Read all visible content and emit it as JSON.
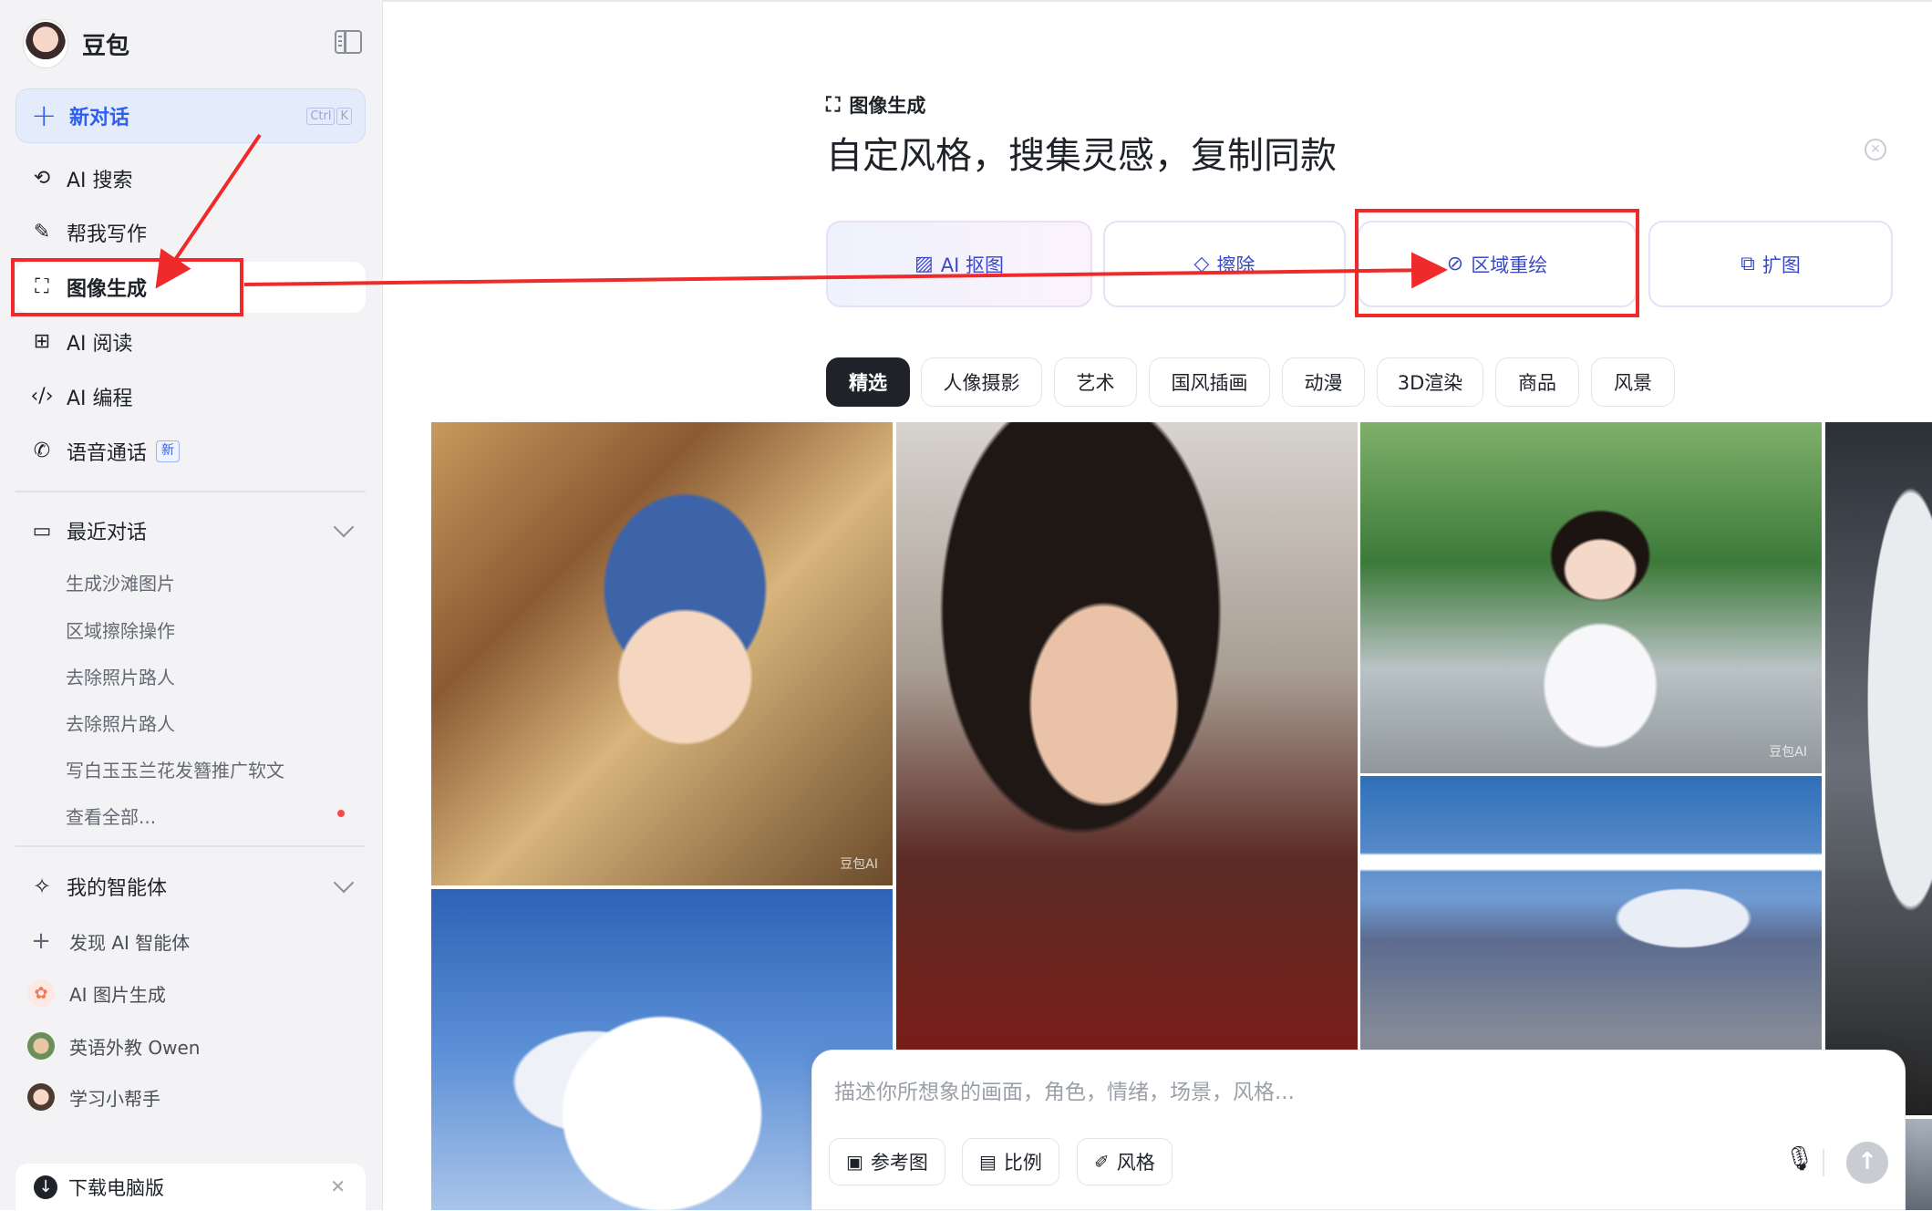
{
  "app": {
    "name": "豆包"
  },
  "sidebar": {
    "new_chat": {
      "label": "新对话",
      "kbd": [
        "Ctrl",
        "K"
      ]
    },
    "items": [
      {
        "label": "AI 搜索",
        "icon": "search-icon"
      },
      {
        "label": "帮我写作",
        "icon": "pen-icon"
      },
      {
        "label": "图像生成",
        "icon": "image-icon"
      },
      {
        "label": "AI 阅读",
        "icon": "book-icon"
      },
      {
        "label": "AI 编程",
        "icon": "code-icon"
      },
      {
        "label": "语音通话",
        "icon": "phone-icon",
        "badge": "新"
      }
    ],
    "recent": {
      "title": "最近对话",
      "items": [
        "生成沙滩图片",
        "区域擦除操作",
        "去除照片路人",
        "去除照片路人",
        "写白玉玉兰花发簪推广软文",
        "查看全部..."
      ]
    },
    "agents": {
      "title": "我的智能体",
      "items": [
        {
          "label": "发现 AI 智能体",
          "icon": "plus-icon"
        },
        {
          "label": "AI 图片生成",
          "icon": "ai-image-avatar"
        },
        {
          "label": "英语外教 Owen",
          "icon": "owen-avatar"
        },
        {
          "label": "学习小帮手",
          "icon": "helper-avatar"
        }
      ]
    },
    "download": {
      "label": "下载电脑版"
    }
  },
  "main": {
    "section_label": "图像生成",
    "title": "自定风格，搜集灵感，复制同款",
    "tools": [
      {
        "label": "AI 抠图",
        "icon": "cutout-icon"
      },
      {
        "label": "擦除",
        "icon": "eraser-icon"
      },
      {
        "label": "区域重绘",
        "icon": "repaint-icon"
      },
      {
        "label": "扩图",
        "icon": "expand-icon"
      }
    ],
    "categories": [
      "精选",
      "人像摄影",
      "艺术",
      "国风插画",
      "动漫",
      "3D渲染",
      "商品",
      "风景"
    ],
    "active_category": "精选",
    "watermark": "豆包AI",
    "composer": {
      "placeholder": "描述你所想象的画面，角色，情绪，场景，风格...",
      "buttons": [
        "参考图",
        "比例",
        "风格"
      ]
    }
  },
  "annotation": {
    "color": "#ef2a2a"
  }
}
